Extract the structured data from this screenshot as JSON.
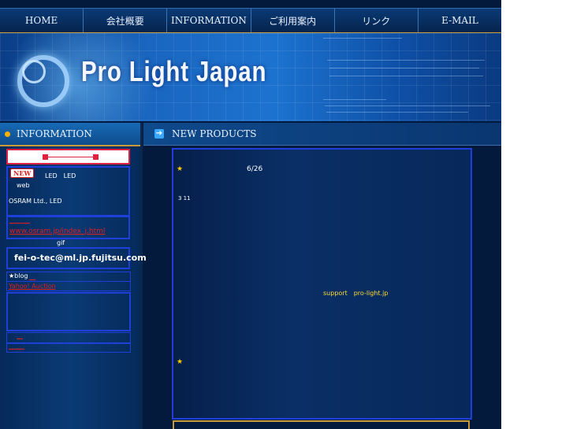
{
  "nav": [
    "HOME",
    "会社概要",
    "INFORMATION",
    "ご利用案内",
    "リンク",
    "E-MAIL"
  ],
  "banner": {
    "brand": "Pro Light Japan"
  },
  "sidebar": {
    "title": "INFORMATION",
    "new_badge": "NEW",
    "led_text": "LED　LED",
    "web": "web",
    "osram": "OSRAM Ltd.,  LED",
    "osram_link": "www.osram.jp/index_j.html",
    "gif": "gif",
    "email": "fei-o-tec@ml.jp.fujitsu.com",
    "blog": "★blog",
    "yahoo": "Yahoo! Auction"
  },
  "main": {
    "title": "NEW PRODUCTS",
    "date": "6/26",
    "stock": "3 11",
    "support": "support　pro-light.jp",
    "star": "★"
  },
  "colors": {
    "accent_gold": "#c79a3a",
    "link_red": "#e02020",
    "box_blue": "#1e3fd8",
    "star_yellow": "#ffcc00"
  }
}
